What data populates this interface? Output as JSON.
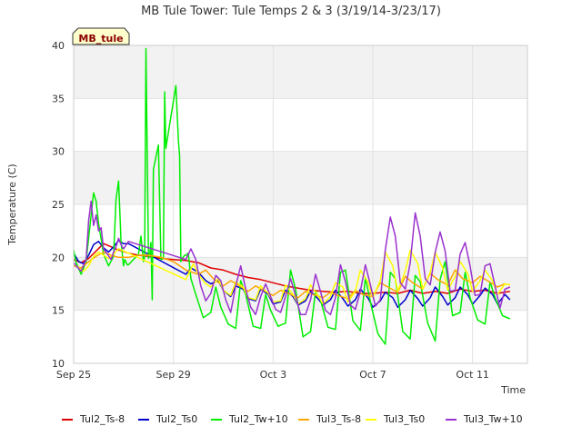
{
  "chart_data": {
    "type": "line",
    "title": "MB Tule Tower: Tule Temps 2 & 3 (3/19/14-3/23/17)",
    "xlabel": "Time",
    "ylabel": "Temperature (C)",
    "station_label": "MB_tule",
    "x_unit": "days since Sep 25",
    "xlim": [
      0,
      18.2
    ],
    "ylim": [
      10,
      40
    ],
    "x_ticks": [
      {
        "x": 0,
        "label": "Sep 25"
      },
      {
        "x": 4,
        "label": "Sep 29"
      },
      {
        "x": 8,
        "label": "Oct 3"
      },
      {
        "x": 12,
        "label": "Oct 7"
      },
      {
        "x": 16,
        "label": "Oct 11"
      }
    ],
    "y_ticks": [
      10,
      15,
      20,
      25,
      30,
      35,
      40
    ],
    "bands": [
      [
        15,
        20
      ],
      [
        25,
        30
      ],
      [
        35,
        40
      ]
    ],
    "grid": true,
    "legend_position": "bottom",
    "series": [
      {
        "name": "Tul2_Ts-8",
        "color": "#e00000",
        "x": [
          0.0,
          0.3,
          0.6,
          0.9,
          1.2,
          1.5,
          1.8,
          2.2,
          2.6,
          3.0,
          3.5,
          4.0,
          4.5,
          5.0,
          5.5,
          6.0,
          6.5,
          7.0,
          7.5,
          8.0,
          8.5,
          9.0,
          9.5,
          10.0,
          10.5,
          11.0,
          11.5,
          12.0,
          12.5,
          13.0,
          13.5,
          14.0,
          14.5,
          15.0,
          15.5,
          16.0,
          16.5,
          17.0,
          17.5
        ],
        "values": [
          19.8,
          19.5,
          19.9,
          20.6,
          21.3,
          21.0,
          20.7,
          20.4,
          20.2,
          20.1,
          19.9,
          19.8,
          19.7,
          19.5,
          19.0,
          18.8,
          18.4,
          18.1,
          17.9,
          17.6,
          17.3,
          17.1,
          16.9,
          16.8,
          16.7,
          16.8,
          16.6,
          16.6,
          16.7,
          16.6,
          16.9,
          16.6,
          16.8,
          16.6,
          17.0,
          16.8,
          16.9,
          16.6,
          16.8
        ]
      },
      {
        "name": "Tul2_Ts0",
        "color": "#0000cc",
        "x": [
          0.0,
          0.2,
          0.4,
          0.6,
          0.8,
          1.0,
          1.2,
          1.4,
          1.6,
          1.8,
          2.0,
          2.2,
          4.5,
          4.7,
          5.0,
          5.3,
          5.5,
          5.8,
          6.0,
          6.3,
          6.5,
          6.8,
          7.0,
          7.3,
          7.5,
          7.8,
          8.0,
          8.3,
          8.5,
          8.8,
          9.0,
          9.3,
          9.5,
          9.8,
          10.0,
          10.3,
          10.5,
          10.8,
          11.0,
          11.3,
          11.5,
          11.8,
          12.0,
          12.3,
          12.5,
          12.8,
          13.0,
          13.3,
          13.5,
          13.8,
          14.0,
          14.3,
          14.5,
          14.8,
          15.0,
          15.3,
          15.5,
          15.8,
          16.0,
          16.3,
          16.5,
          16.8,
          17.0,
          17.3,
          17.5
        ],
        "values": [
          20.4,
          19.6,
          19.4,
          20.2,
          21.2,
          21.5,
          20.9,
          20.5,
          21.0,
          21.6,
          21.3,
          21.3,
          18.4,
          19.0,
          18.6,
          17.8,
          17.5,
          17.8,
          16.9,
          16.3,
          17.3,
          17.0,
          16.1,
          15.9,
          17.0,
          16.5,
          15.6,
          15.8,
          16.9,
          16.3,
          15.5,
          15.9,
          16.8,
          16.1,
          15.5,
          16.0,
          16.9,
          16.1,
          15.4,
          16.0,
          17.0,
          16.2,
          15.3,
          15.9,
          16.7,
          16.2,
          15.3,
          16.0,
          16.9,
          16.1,
          15.4,
          16.2,
          17.2,
          16.3,
          15.5,
          16.2,
          17.2,
          16.5,
          15.6,
          16.4,
          17.1,
          16.5,
          15.6,
          16.5,
          16.0
        ]
      },
      {
        "name": "Tul2_Tw+10",
        "color": "#00ee00",
        "x": [
          0.0,
          0.1,
          0.3,
          0.5,
          0.7,
          0.8,
          0.9,
          1.0,
          1.2,
          1.4,
          1.6,
          1.7,
          1.8,
          1.9,
          2.0,
          2.05,
          2.15,
          2.2,
          2.6,
          2.7,
          2.8,
          2.85,
          2.9,
          3.0,
          3.05,
          3.1,
          3.15,
          3.2,
          3.4,
          3.5,
          3.6,
          3.65,
          3.7,
          4.1,
          4.2,
          4.25,
          4.3,
          4.35,
          4.45,
          4.5,
          4.6,
          4.7,
          4.9,
          5.2,
          5.5,
          5.7,
          5.9,
          6.2,
          6.5,
          6.7,
          6.9,
          7.2,
          7.5,
          7.7,
          7.9,
          8.2,
          8.5,
          8.7,
          8.9,
          9.2,
          9.5,
          9.7,
          9.9,
          10.2,
          10.5,
          10.7,
          10.9,
          11.2,
          11.5,
          11.7,
          11.9,
          12.2,
          12.5,
          12.7,
          12.9,
          13.2,
          13.5,
          13.7,
          13.9,
          14.2,
          14.5,
          14.7,
          14.9,
          15.2,
          15.5,
          15.7,
          15.9,
          16.2,
          16.5,
          16.7,
          16.9,
          17.2,
          17.5
        ],
        "values": [
          20.7,
          19.5,
          18.4,
          19.6,
          24.0,
          26.1,
          25.3,
          23.2,
          20.3,
          19.2,
          20.1,
          25.5,
          27.2,
          21.5,
          19.2,
          19.8,
          19.3,
          19.3,
          20.3,
          22.0,
          19.6,
          20.1,
          39.7,
          19.9,
          20.2,
          21.4,
          16.0,
          28.3,
          30.6,
          19.8,
          19.9,
          35.6,
          30.3,
          36.2,
          31.0,
          29.6,
          19.6,
          19.9,
          20.2,
          20.2,
          20.4,
          18.0,
          16.5,
          14.3,
          14.8,
          17.2,
          15.3,
          13.7,
          13.3,
          17.8,
          16.5,
          13.5,
          13.3,
          16.5,
          15.0,
          13.5,
          13.8,
          18.8,
          17.0,
          12.5,
          13.0,
          16.8,
          16.0,
          13.4,
          13.2,
          18.6,
          18.8,
          14.0,
          13.1,
          18.1,
          15.8,
          12.8,
          11.8,
          18.6,
          18.0,
          13.0,
          12.3,
          18.3,
          17.7,
          13.8,
          12.1,
          17.9,
          19.6,
          14.5,
          14.8,
          18.6,
          16.2,
          14.1,
          13.7,
          17.7,
          16.2,
          14.5,
          14.2
        ]
      },
      {
        "name": "Tul3_Ts-8",
        "color": "#ffa500",
        "x": [
          0.0,
          0.3,
          0.6,
          0.9,
          1.2,
          1.5,
          1.8,
          2.2,
          2.6,
          3.0,
          3.5,
          4.0,
          4.5,
          5.0,
          5.3,
          5.6,
          6.0,
          6.3,
          6.6,
          7.0,
          7.3,
          7.6,
          8.0,
          8.3,
          8.6,
          9.0,
          9.3,
          9.6,
          10.0,
          10.3,
          10.6,
          11.0,
          11.3,
          11.6,
          12.0,
          12.3,
          12.6,
          13.0,
          13.3,
          13.6,
          14.0,
          14.3,
          14.6,
          15.0,
          15.3,
          15.6,
          16.0,
          16.3,
          16.6,
          17.0,
          17.3,
          17.5
        ],
        "values": [
          19.2,
          19.0,
          19.6,
          20.1,
          20.5,
          20.2,
          20.0,
          20.0,
          20.2,
          20.2,
          20.0,
          19.6,
          18.8,
          18.4,
          18.8,
          18.0,
          17.3,
          17.8,
          17.4,
          16.8,
          17.3,
          16.9,
          16.4,
          16.9,
          16.6,
          16.2,
          16.8,
          16.5,
          16.2,
          16.7,
          16.4,
          16.1,
          16.9,
          16.5,
          16.3,
          17.6,
          17.2,
          16.7,
          18.2,
          17.6,
          17.0,
          18.5,
          17.9,
          17.4,
          18.8,
          18.0,
          17.6,
          18.2,
          17.8,
          17.2,
          17.5,
          17.4
        ]
      },
      {
        "name": "Tul3_Ts0",
        "color": "#ffff00",
        "x": [
          0.0,
          0.2,
          0.4,
          0.6,
          0.8,
          1.0,
          1.2,
          1.4,
          1.6,
          1.8,
          2.0,
          2.2,
          4.5,
          4.8,
          5.0,
          5.3,
          5.5,
          5.8,
          6.0,
          6.3,
          6.5,
          6.8,
          7.0,
          7.3,
          7.5,
          7.8,
          8.0,
          8.3,
          8.5,
          8.8,
          9.0,
          9.3,
          9.5,
          9.8,
          10.0,
          10.3,
          10.5,
          10.8,
          11.0,
          11.3,
          11.5,
          11.8,
          12.0,
          12.3,
          12.5,
          12.8,
          13.0,
          13.3,
          13.5,
          13.8,
          14.0,
          14.3,
          14.5,
          14.8,
          15.0,
          15.3,
          15.5,
          15.8,
          16.0,
          16.3,
          16.5,
          16.8,
          17.0,
          17.3,
          17.5
        ],
        "values": [
          19.4,
          19.0,
          18.7,
          19.2,
          20.1,
          20.5,
          20.2,
          19.9,
          20.3,
          20.8,
          20.6,
          20.4,
          17.9,
          19.4,
          18.4,
          17.5,
          17.2,
          18.0,
          16.9,
          16.4,
          17.7,
          17.2,
          16.2,
          16.0,
          17.3,
          16.6,
          15.8,
          15.9,
          17.4,
          16.5,
          15.6,
          16.1,
          17.4,
          16.4,
          15.6,
          16.3,
          17.6,
          17.2,
          15.8,
          16.8,
          18.8,
          17.7,
          16.2,
          17.8,
          20.5,
          19.2,
          16.8,
          18.7,
          20.7,
          19.4,
          17.0,
          18.6,
          20.5,
          19.0,
          16.9,
          18.2,
          19.6,
          18.5,
          16.8,
          17.8,
          18.8,
          17.8,
          16.5,
          17.5,
          17.4
        ]
      },
      {
        "name": "Tul3_Tw+10",
        "color": "#9a32cd",
        "x": [
          0.0,
          0.1,
          0.3,
          0.5,
          0.6,
          0.7,
          0.8,
          0.9,
          1.0,
          1.1,
          1.2,
          1.35,
          1.5,
          1.6,
          1.7,
          1.8,
          1.9,
          2.0,
          2.2,
          4.5,
          4.7,
          4.9,
          5.1,
          5.3,
          5.5,
          5.7,
          5.9,
          6.1,
          6.3,
          6.5,
          6.7,
          6.9,
          7.1,
          7.3,
          7.5,
          7.7,
          7.9,
          8.1,
          8.3,
          8.5,
          8.7,
          8.9,
          9.1,
          9.3,
          9.5,
          9.7,
          9.9,
          10.1,
          10.3,
          10.5,
          10.7,
          10.9,
          11.1,
          11.3,
          11.5,
          11.7,
          11.9,
          12.1,
          12.3,
          12.5,
          12.7,
          12.9,
          13.1,
          13.3,
          13.5,
          13.7,
          13.9,
          14.1,
          14.3,
          14.5,
          14.7,
          14.9,
          15.1,
          15.3,
          15.5,
          15.7,
          15.9,
          16.1,
          16.3,
          16.5,
          16.7,
          16.9,
          17.1,
          17.3,
          17.5
        ],
        "values": [
          19.5,
          19.2,
          18.7,
          19.8,
          23.5,
          25.3,
          23.0,
          24.0,
          22.5,
          22.8,
          20.8,
          20.3,
          19.8,
          20.5,
          21.0,
          21.8,
          21.2,
          20.8,
          21.5,
          19.8,
          20.8,
          19.8,
          17.3,
          15.9,
          16.6,
          18.3,
          17.8,
          16.0,
          14.8,
          17.3,
          19.2,
          17.0,
          15.3,
          14.6,
          16.3,
          17.5,
          16.3,
          15.1,
          14.8,
          16.3,
          18.0,
          16.4,
          14.6,
          14.6,
          16.0,
          18.4,
          16.8,
          15.0,
          14.6,
          16.2,
          19.3,
          17.7,
          15.5,
          15.1,
          16.8,
          19.3,
          17.4,
          15.4,
          16.0,
          20.7,
          23.8,
          22.0,
          17.6,
          17.0,
          19.5,
          24.2,
          22.0,
          18.0,
          17.4,
          20.5,
          22.4,
          20.6,
          16.8,
          16.9,
          20.3,
          21.4,
          19.2,
          16.4,
          16.5,
          19.2,
          19.4,
          17.3,
          15.2,
          17.0,
          17.2
        ]
      }
    ]
  }
}
